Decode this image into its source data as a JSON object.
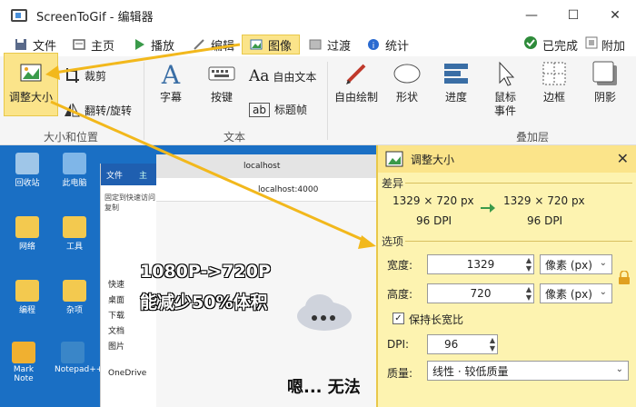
{
  "window": {
    "title": "ScreenToGif - 编辑器",
    "min": "—",
    "max": "☐",
    "close": "✕"
  },
  "tabs": [
    {
      "label": "文件"
    },
    {
      "label": "主页"
    },
    {
      "label": "播放"
    },
    {
      "label": "编辑"
    },
    {
      "label": "图像"
    },
    {
      "label": "过渡"
    },
    {
      "label": "统计"
    }
  ],
  "tabs_right": {
    "done": "已完成",
    "attach": "附加"
  },
  "ribbon": {
    "resize": "调整大小",
    "crop": "裁剪",
    "flip": "翻转/旋转",
    "group_size": "大小和位置",
    "caption": "字幕",
    "keys": "按键",
    "freetext": "自由文本",
    "titleframe": "标题帧",
    "group_text": "文本",
    "freedraw": "自由绘制",
    "shape": "形状",
    "progress": "进度",
    "mouse1": "鼠标",
    "mouse2": "事件",
    "border": "边框",
    "shadow": "阴影",
    "group_overlay": "叠加层",
    "aa": "Aa",
    "ab": "ab"
  },
  "desktop": {
    "icons": [
      "回收站",
      "此电脑",
      "网络",
      "工具",
      "编程",
      "杂项",
      "Mark Note",
      "Notepad++"
    ],
    "explorer": {
      "tab1": "文件",
      "tab2": "主",
      "pin": "固定到快速访问",
      "copy": "复制",
      "quick": "快速",
      "desktop": "桌面",
      "downloads": "下载",
      "docs": "文档",
      "pics": "图片",
      "onedrive": "OneDrive"
    },
    "browser": {
      "tab": "localhost",
      "url": "localhost:4000",
      "body": "嗯... 无法"
    },
    "overlay": {
      "line1": "1080P->720P",
      "line2": "能减少50%体积"
    }
  },
  "panel": {
    "title": "调整大小",
    "diff": "差异",
    "from_size": "1329 × 720 px",
    "from_dpi": "96 DPI",
    "to_size": "1329 × 720 px",
    "to_dpi": "96 DPI",
    "options": "选项",
    "width_label": "宽度:",
    "width_value": "1329",
    "height_label": "高度:",
    "height_value": "720",
    "unit": "像素 (px)",
    "keep_ratio": "保持长宽比",
    "dpi_label": "DPI:",
    "dpi_value": "96",
    "quality_label": "质量:",
    "quality_value": "线性 · 较低质量"
  },
  "colors": {
    "accent": "#fbe48a",
    "panel": "#fdf3b0",
    "arrow": "#f2b81c"
  }
}
